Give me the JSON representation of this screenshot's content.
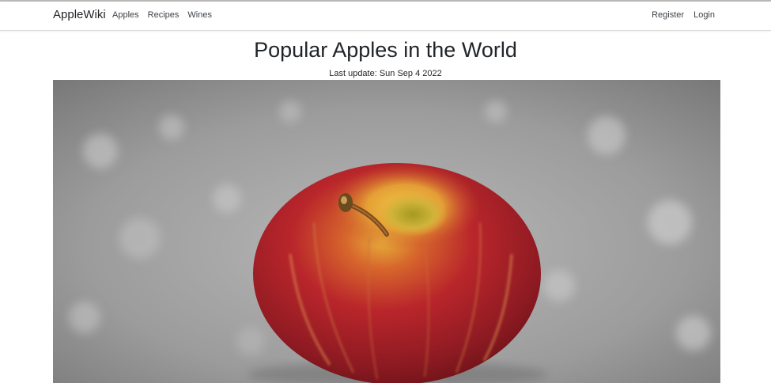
{
  "navbar": {
    "brand": "AppleWiki",
    "left_links": [
      {
        "label": "Apples"
      },
      {
        "label": "Recipes"
      },
      {
        "label": "Wines"
      }
    ],
    "right_links": [
      {
        "label": "Register"
      },
      {
        "label": "Login"
      }
    ]
  },
  "main": {
    "title": "Popular Apples in the World",
    "last_update": "Last update: Sun Sep 4 2022"
  },
  "colors": {
    "apple_red": "#b3222a",
    "apple_yellow": "#e8b83a",
    "background_gray": "#9a9a9a"
  }
}
